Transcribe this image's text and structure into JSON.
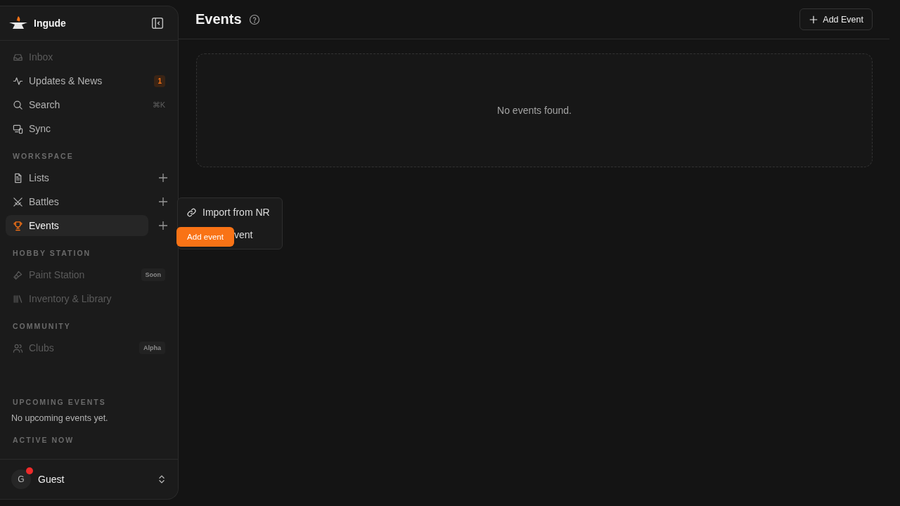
{
  "sidebar": {
    "brand": "Ingude",
    "top_items": [
      {
        "label": "Inbox",
        "disabled": true
      },
      {
        "label": "Updates & News",
        "disabled": false,
        "badge": "1"
      },
      {
        "label": "Search",
        "disabled": false,
        "shortcut": "⌘K"
      },
      {
        "label": "Sync",
        "disabled": false
      }
    ],
    "sections": [
      {
        "title": "WORKSPACE",
        "items": [
          {
            "label": "Lists",
            "selected": false,
            "disabled": false,
            "add": true
          },
          {
            "label": "Battles",
            "selected": false,
            "disabled": false,
            "add": true
          },
          {
            "label": "Events",
            "selected": true,
            "disabled": false,
            "add": true
          }
        ]
      },
      {
        "title": "HOBBY STATION",
        "items": [
          {
            "label": "Paint Station",
            "selected": false,
            "disabled": true,
            "tag": "Soon"
          },
          {
            "label": "Inventory & Library",
            "selected": false,
            "disabled": true
          }
        ]
      },
      {
        "title": "COMMUNITY",
        "items": [
          {
            "label": "Clubs",
            "selected": false,
            "disabled": true,
            "tag": "Alpha"
          }
        ]
      }
    ],
    "upcoming": {
      "title": "UPCOMING EVENTS",
      "text": "No upcoming events yet."
    },
    "active_now": {
      "title": "ACTIVE NOW"
    },
    "user": {
      "initial": "G",
      "name": "Guest",
      "notification": true
    }
  },
  "header": {
    "title": "Events",
    "add_button": "Add Event"
  },
  "empty_text": "No events found.",
  "menu": {
    "items": [
      {
        "label": "Import from NR"
      },
      {
        "label": "vent"
      }
    ]
  },
  "tooltip": "Add event"
}
